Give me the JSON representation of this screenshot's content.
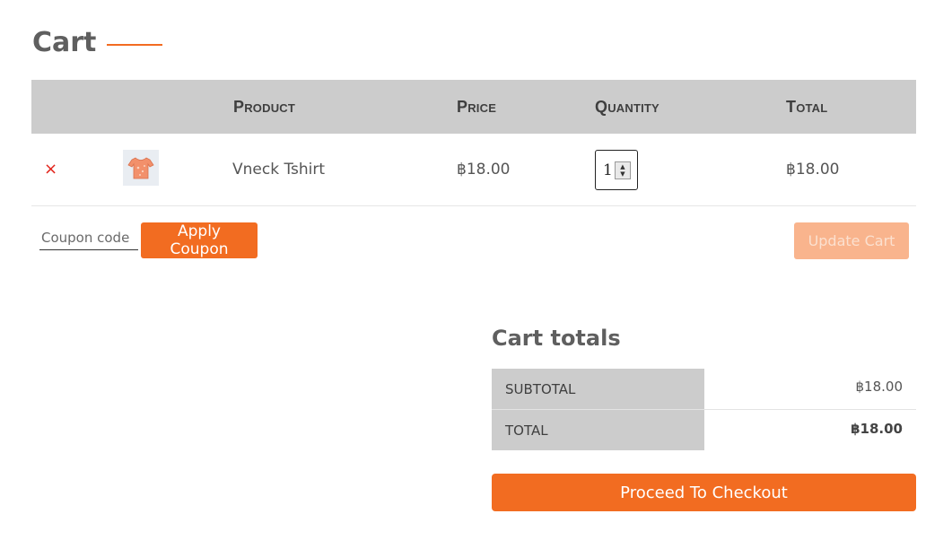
{
  "page_title": "Cart",
  "table": {
    "headers": [
      "Product",
      "Price",
      "Quantity",
      "Total"
    ],
    "rows": [
      {
        "remove_icon": "×",
        "thumbnail_icon": "tshirt-icon",
        "product": "Vneck Tshirt",
        "price": "฿18.00",
        "quantity": "1",
        "total": "฿18.00"
      }
    ]
  },
  "coupon": {
    "placeholder": "Coupon code",
    "apply_label": "Apply Coupon"
  },
  "update_label": "Update Cart",
  "totals": {
    "title": "Cart totals",
    "subtotal_label": "SUBTOTAL",
    "subtotal_value": "฿18.00",
    "total_label": "TOTAL",
    "total_value": "฿18.00"
  },
  "checkout_label": "Proceed To Checkout",
  "colors": {
    "accent": "#f26c21",
    "accent_disabled": "#f9b48d",
    "header_bg": "#cccccc",
    "remove": "#e2231a"
  }
}
